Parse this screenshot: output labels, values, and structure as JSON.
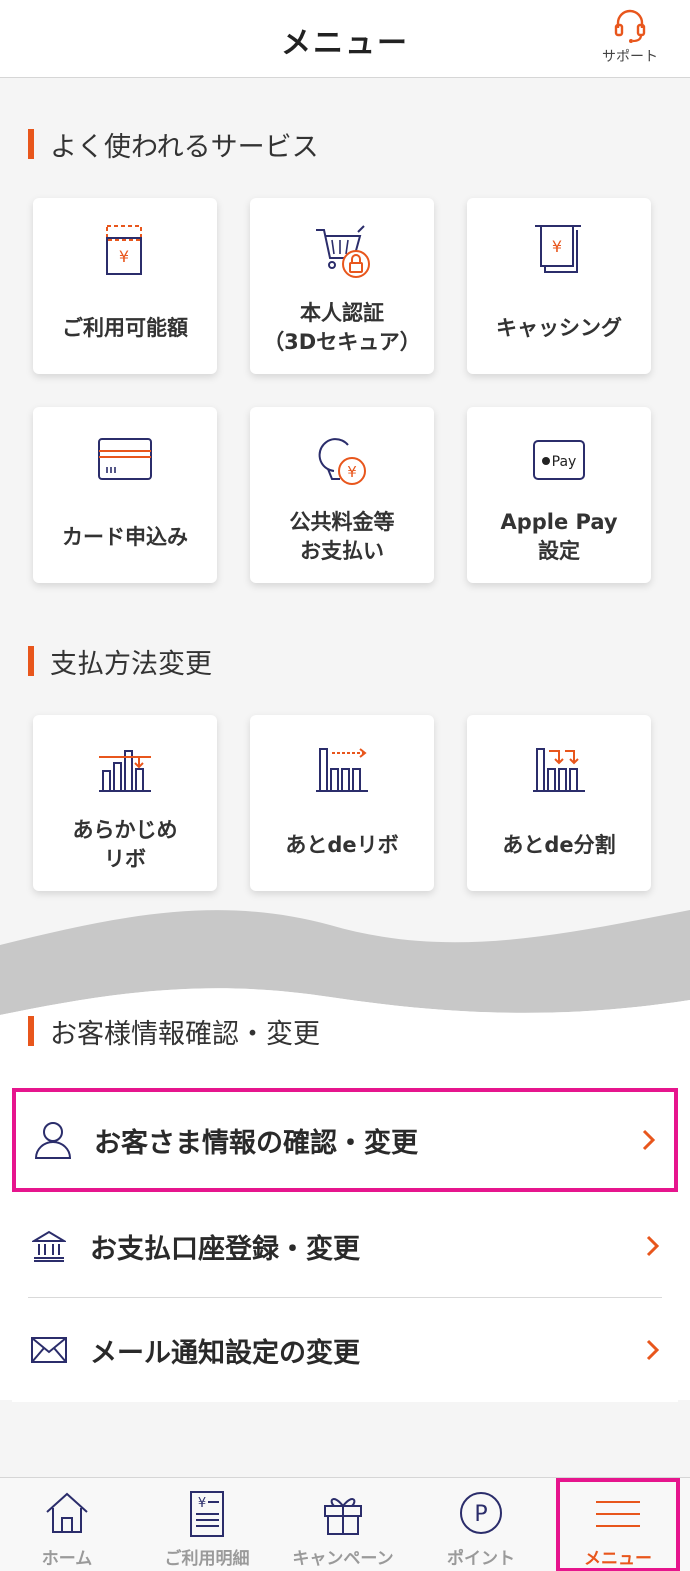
{
  "header": {
    "title": "メニュー",
    "support_label": "サポート"
  },
  "sections": {
    "frequent": {
      "title": "よく使われるサービス",
      "tiles": [
        {
          "label": "ご利用可能額",
          "icon": "yen-card-icon"
        },
        {
          "label": "本人認証\n（3Dセキュア）",
          "icon": "cart-lock-icon"
        },
        {
          "label": "キャッシング",
          "icon": "atm-yen-icon"
        },
        {
          "label": "カード申込み",
          "icon": "credit-card-icon"
        },
        {
          "label": "公共料金等\nお支払い",
          "icon": "bulb-yen-icon"
        },
        {
          "label": "Apple Pay\n設定",
          "icon": "apple-pay-icon"
        }
      ]
    },
    "payment": {
      "title": "支払方法変更",
      "tiles": [
        {
          "label": "あらかじめ\nリボ",
          "icon": "bars-arrow-down-icon"
        },
        {
          "label": "あとdeリボ",
          "icon": "bars-arrow-right-icon"
        },
        {
          "label": "あとde分割",
          "icon": "bars-split-icon"
        }
      ]
    },
    "customer": {
      "title": "お客様情報確認・変更",
      "items": [
        {
          "label": "お客さま情報の確認・変更",
          "icon": "person-icon"
        },
        {
          "label": "お支払口座登録・変更",
          "icon": "bank-icon"
        },
        {
          "label": "メール通知設定の変更",
          "icon": "mail-icon"
        }
      ]
    }
  },
  "nav": {
    "items": [
      {
        "label": "ホーム",
        "icon": "home-icon"
      },
      {
        "label": "ご利用明細",
        "icon": "statement-icon"
      },
      {
        "label": "キャンペーン",
        "icon": "gift-icon"
      },
      {
        "label": "ポイント",
        "icon": "point-icon"
      },
      {
        "label": "メニュー",
        "icon": "menu-icon"
      }
    ],
    "active": "メニュー"
  },
  "colors": {
    "accent": "#e8561c",
    "navy": "#2b2d6b",
    "highlight": "#e6158d"
  }
}
